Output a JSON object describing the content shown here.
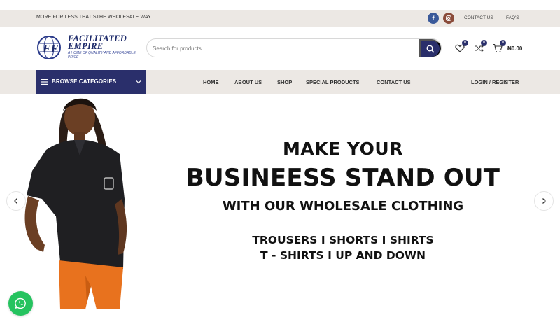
{
  "topbar": {
    "promo": "MORE FOR LESS THAT STHE WHOLESALE WAY",
    "links": [
      "CONTACT US",
      "FAQ'S"
    ],
    "social_icons": [
      "facebook-icon",
      "instagram-icon"
    ]
  },
  "header": {
    "logo_title_line1": "FACILITATED",
    "logo_title_line2": "EMPIRE",
    "logo_monogram": "FE",
    "logo_tagline": "A HOME OF QUALITY AND AFFORDABLE PRICE",
    "search_placeholder": "Search for products",
    "wishlist_count": "0",
    "compare_count": "0",
    "cart_count": "0",
    "cart_total": "₦0.00"
  },
  "nav": {
    "browse_label": "BROWSE CATEGORIES",
    "items": [
      "HOME",
      "ABOUT US",
      "SHOP",
      "SPECIAL PRODUCTS",
      "CONTACT US"
    ],
    "active_item": "HOME",
    "login_label": "LOGIN / REGISTER"
  },
  "hero": {
    "line1": "MAKE YOUR",
    "line2": "BUSINEESS STAND OUT",
    "line3": "WITH OUR WHOLESALE CLOTHING",
    "line4": "TROUSERS I SHORTS I SHIRTS",
    "line5": "T - SHIRTS I UP AND DOWN"
  },
  "colors": {
    "brand_navy": "#2a2f6b",
    "topbar_bg": "#ece8e4",
    "whatsapp_green": "#25c35f",
    "facebook_blue": "#3b5a9a"
  }
}
